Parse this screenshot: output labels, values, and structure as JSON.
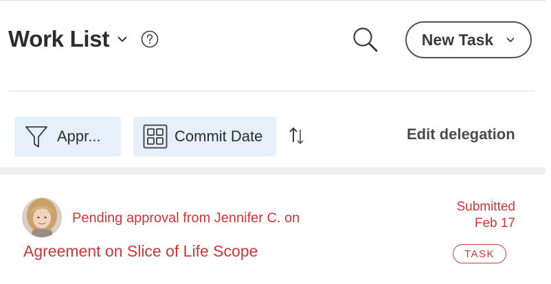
{
  "header": {
    "title": "Work List",
    "title_dropdown_icon": "chevron-down-icon",
    "help_icon": "question-circle-icon",
    "search_icon": "search-icon",
    "new_task_label": "New Task",
    "new_task_icon": "chevron-down-icon"
  },
  "toolbar": {
    "filter_label": "Appr...",
    "filter_icon": "funnel-icon",
    "group_label": "Commit Date",
    "group_icon": "grid-icon",
    "sort_icon": "sort-arrows-icon",
    "edit_delegation_label": "Edit delegation"
  },
  "work_items": [
    {
      "avatar": "avatar",
      "status_text": "Pending approval from Jennifer C. on",
      "title": "Agreement on Slice of Life Scope",
      "submitted_label": "Submitted",
      "submitted_date": "Feb 17",
      "badge": "TASK"
    }
  ],
  "colors": {
    "accent_red": "#c8383a",
    "chip_bg": "#e5f0fa",
    "title_text": "#2c2c2c"
  }
}
